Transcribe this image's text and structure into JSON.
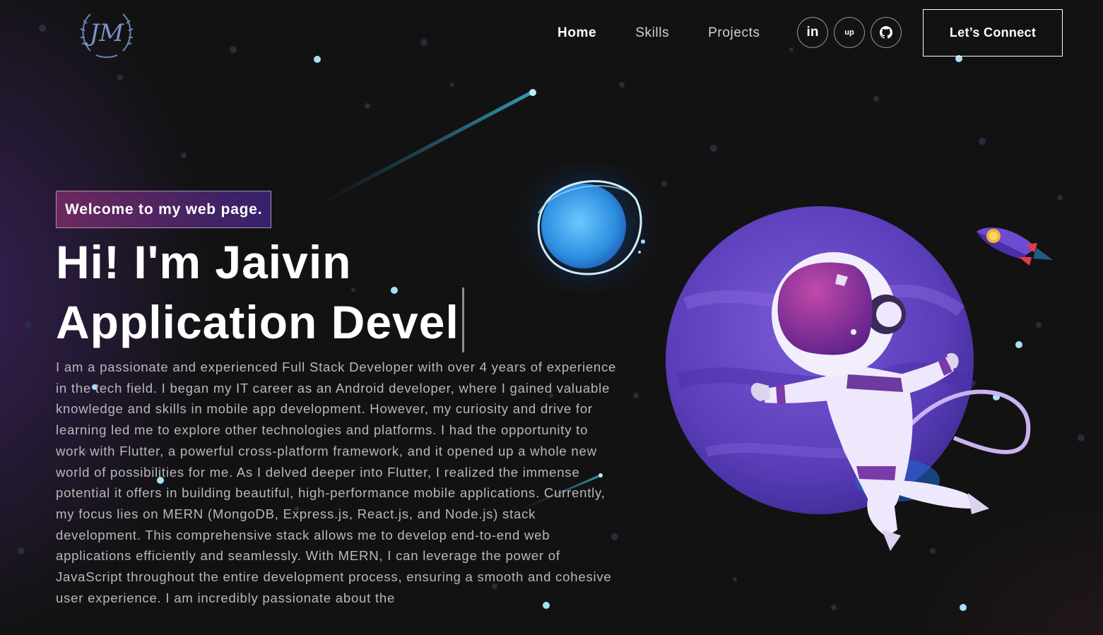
{
  "nav": {
    "logo_text": "JM",
    "links": [
      {
        "label": "Home",
        "active": true
      },
      {
        "label": "Skills",
        "active": false
      },
      {
        "label": "Projects",
        "active": false
      }
    ],
    "socials": [
      {
        "icon": "linkedin-icon",
        "label": "in"
      },
      {
        "icon": "upwork-icon",
        "label": "up"
      },
      {
        "icon": "github-icon",
        "label": ""
      }
    ],
    "connect_label": "Let’s Connect"
  },
  "hero": {
    "tagline": "Welcome to my web page.",
    "headline_line1": "Hi! I'm Jaivin",
    "headline_line2": "Application Devel",
    "bio": "I am a passionate and experienced Full Stack Developer with over 4 years of experience in the tech field. I began my IT career as an Android developer, where I gained valuable knowledge and skills in mobile app development. However, my curiosity and drive for learning led me to explore other technologies and platforms. I had the opportunity to work with Flutter, a powerful cross-platform framework, and it opened up a whole new world of possibilities for me. As I delved deeper into Flutter, I realized the immense potential it offers in building beautiful, high-performance mobile applications. Currently, my focus lies on MERN (MongoDB, Express.js, React.js, and Node.js) stack development. This comprehensive stack allows me to develop end-to-end web applications efficiently and seamlessly. With MERN, I can leverage the power of JavaScript throughout the entire development process, ensuring a smooth and cohesive user experience. I am incredibly passionate about the"
  },
  "colors": {
    "background": "#121212",
    "tag_gradient_start": "#aa367c",
    "tag_gradient_end": "#4a2fbd",
    "planet": "#6a4cc8",
    "star": "#a8e0f5"
  }
}
